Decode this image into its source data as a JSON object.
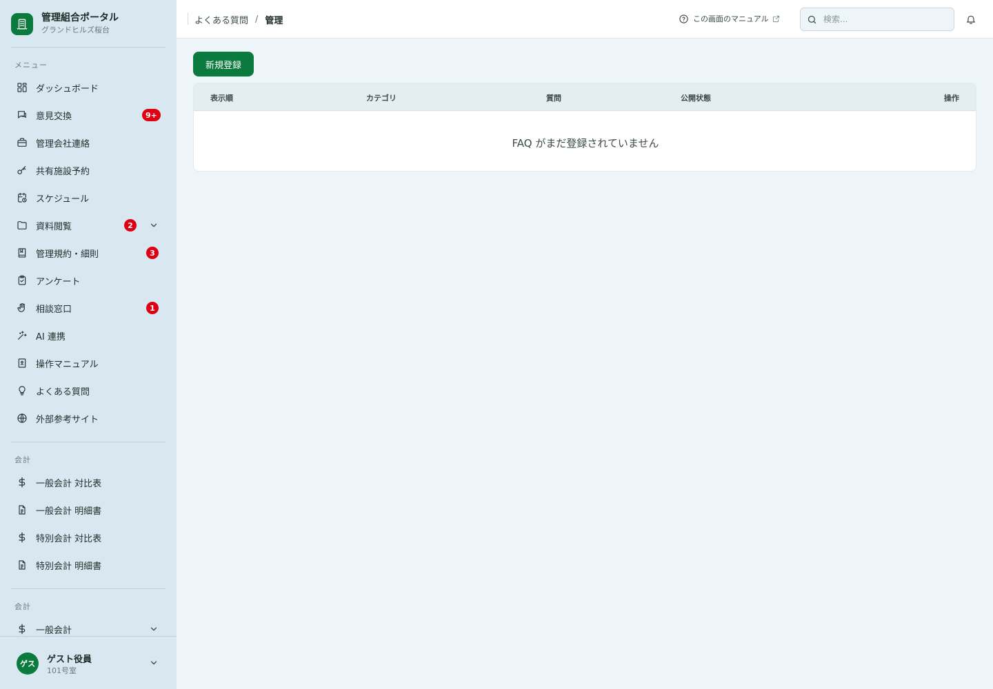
{
  "brand": {
    "title": "管理組合ポータル",
    "subtitle": "グランドヒルズ桜台"
  },
  "sections": {
    "menu": "メニュー",
    "accounting1": "会計",
    "accounting2": "会計"
  },
  "menu_items": [
    {
      "label": "ダッシュボード",
      "icon": "dashboard-icon"
    },
    {
      "label": "意見交換",
      "icon": "chat-icon",
      "badge": "9+"
    },
    {
      "label": "管理会社連絡",
      "icon": "briefcase-icon"
    },
    {
      "label": "共有施設予約",
      "icon": "key-icon"
    },
    {
      "label": "スケジュール",
      "icon": "calendar-clock-icon"
    },
    {
      "label": "資料閲覧",
      "icon": "folder-icon",
      "badge": "2"
    },
    {
      "label": "管理規約・細則",
      "icon": "book-icon",
      "badge": "3"
    },
    {
      "label": "アンケート",
      "icon": "clipboard-icon"
    },
    {
      "label": "相談窓口",
      "icon": "hand-icon",
      "badge": "1"
    },
    {
      "label": "AI 連携",
      "icon": "sparkle-icon"
    },
    {
      "label": "操作マニュアル",
      "icon": "manual-icon"
    },
    {
      "label": "よくある質問",
      "icon": "lightbulb-icon"
    },
    {
      "label": "外部参考サイト",
      "icon": "globe-icon"
    }
  ],
  "accounting_items": [
    {
      "label": "一般会計 対比表",
      "icon": "dollar-icon"
    },
    {
      "label": "一般会計 明細書",
      "icon": "document-icon"
    },
    {
      "label": "特別会計 対比表",
      "icon": "dollar-icon"
    },
    {
      "label": "特別会計 明細書",
      "icon": "document-icon"
    }
  ],
  "accounting2_items": [
    {
      "label": "一般会計",
      "icon": "dollar-icon"
    }
  ],
  "user": {
    "avatar": "ゲス",
    "name": "ゲスト役員",
    "room": "101号室"
  },
  "header": {
    "breadcrumb": [
      "よくある質問",
      "管理"
    ],
    "separator": "/",
    "manual_link": "この画面のマニュアル",
    "search_placeholder": "検索..."
  },
  "main": {
    "new_button": "新規登録",
    "columns": [
      "表示順",
      "カテゴリ",
      "質問",
      "公開状態",
      "操作"
    ],
    "empty_message": "FAQ がまだ登録されていません"
  },
  "colors": {
    "accent": "#0b7a3e",
    "badge": "#e00014",
    "sidebar": "#d8e7f0"
  }
}
